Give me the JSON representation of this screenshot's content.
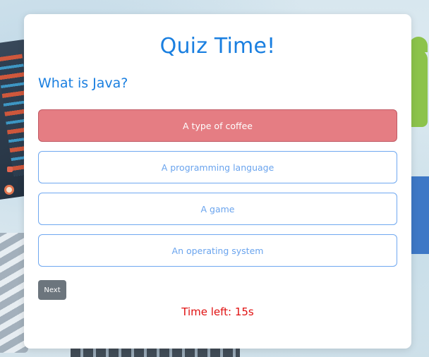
{
  "quiz": {
    "title": "Quiz Time!",
    "question": "What is Java?",
    "options": [
      {
        "label": "A type of coffee",
        "state": "incorrect-selected"
      },
      {
        "label": "A programming language",
        "state": "default"
      },
      {
        "label": "A game",
        "state": "default"
      },
      {
        "label": "An operating system",
        "state": "default"
      }
    ],
    "next_label": "Next",
    "timer_text": "Time left: 15s"
  },
  "colors": {
    "accent": "#1a7fe0",
    "option_border": "#6fa8f0",
    "wrong_bg": "#e57d83",
    "next_bg": "#6c757d",
    "timer": "#e01010"
  }
}
